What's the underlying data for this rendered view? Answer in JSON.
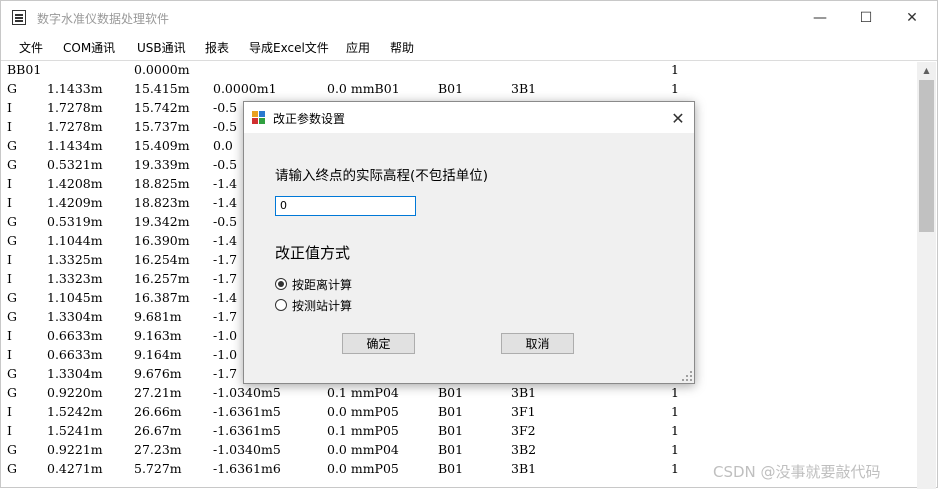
{
  "window": {
    "title": "数字水准仪数据处理软件",
    "minimize_glyph": "—",
    "maximize_glyph": "☐",
    "close_glyph": "✕"
  },
  "menu": [
    "文件",
    "COM通讯",
    "USB通讯",
    "报表",
    "导成Excel文件",
    "应用",
    "帮助"
  ],
  "data_rows": [
    [
      "BB01",
      "",
      "0.0000m",
      "",
      "",
      "",
      "",
      "1"
    ],
    [
      "G",
      "1.1433m",
      "15.415m",
      "0.0000m1",
      "0.0 mmB01",
      "B01",
      "3B1",
      "1"
    ],
    [
      "I",
      "1.7278m",
      "15.742m",
      "-0.5",
      "",
      "",
      "",
      ""
    ],
    [
      "I",
      "1.7278m",
      "15.737m",
      "-0.5",
      "",
      "",
      "",
      ""
    ],
    [
      "G",
      "1.1434m",
      "15.409m",
      "0.0",
      "",
      "",
      "",
      ""
    ],
    [
      "G",
      "0.5321m",
      "19.339m",
      "-0.5",
      "",
      "",
      "",
      ""
    ],
    [
      "I",
      "1.4208m",
      "18.825m",
      "-1.4",
      "",
      "",
      "",
      ""
    ],
    [
      "I",
      "1.4209m",
      "18.823m",
      "-1.4",
      "",
      "",
      "",
      ""
    ],
    [
      "G",
      "0.5319m",
      "19.342m",
      "-0.5",
      "",
      "",
      "",
      ""
    ],
    [
      "G",
      "1.1044m",
      "16.390m",
      "-1.4",
      "",
      "",
      "",
      ""
    ],
    [
      "I",
      "1.3325m",
      "16.254m",
      "-1.7",
      "",
      "",
      "",
      ""
    ],
    [
      "I",
      "1.3323m",
      "16.257m",
      "-1.7",
      "",
      "",
      "",
      ""
    ],
    [
      "G",
      "1.1045m",
      "16.387m",
      "-1.4",
      "",
      "",
      "",
      ""
    ],
    [
      "G",
      "1.3304m",
      "9.681m",
      "-1.7",
      "",
      "",
      "",
      ""
    ],
    [
      "I",
      "0.6633m",
      "9.163m",
      "-1.0",
      "",
      "",
      "",
      ""
    ],
    [
      "I",
      "0.6633m",
      "9.164m",
      "-1.0",
      "",
      "",
      "",
      ""
    ],
    [
      "G",
      "1.3304m",
      "9.676m",
      "-1.7",
      "",
      "",
      "",
      ""
    ],
    [
      "G",
      "0.9220m",
      "27.21m",
      "-1.0340m5",
      "0.1 mmP04",
      "B01",
      "3B1",
      "1"
    ],
    [
      "I",
      "1.5242m",
      "26.66m",
      "-1.6361m5",
      "0.0 mmP05",
      "B01",
      "3F1",
      "1"
    ],
    [
      "I",
      "1.5241m",
      "26.67m",
      "-1.6361m5",
      "0.1 mmP05",
      "B01",
      "3F2",
      "1"
    ],
    [
      "G",
      "0.9221m",
      "27.23m",
      "-1.0340m5",
      "0.0 mmP04",
      "B01",
      "3B2",
      "1"
    ],
    [
      "G",
      "0.4271m",
      "5.727m",
      "-1.6361m6",
      "0.0 mmP05",
      "B01",
      "3B1",
      "1"
    ]
  ],
  "dialog": {
    "title": "改正参数设置",
    "close_glyph": "✕",
    "prompt": "请输入终点的实际高程(不包括单位)",
    "elevation_value": "0",
    "group_title": "改正值方式",
    "options": [
      {
        "label": "按距离计算",
        "selected": true
      },
      {
        "label": "按测站计算",
        "selected": false
      }
    ],
    "ok_label": "确定",
    "cancel_label": "取消"
  },
  "watermark": "CSDN @没事就要敲代码"
}
